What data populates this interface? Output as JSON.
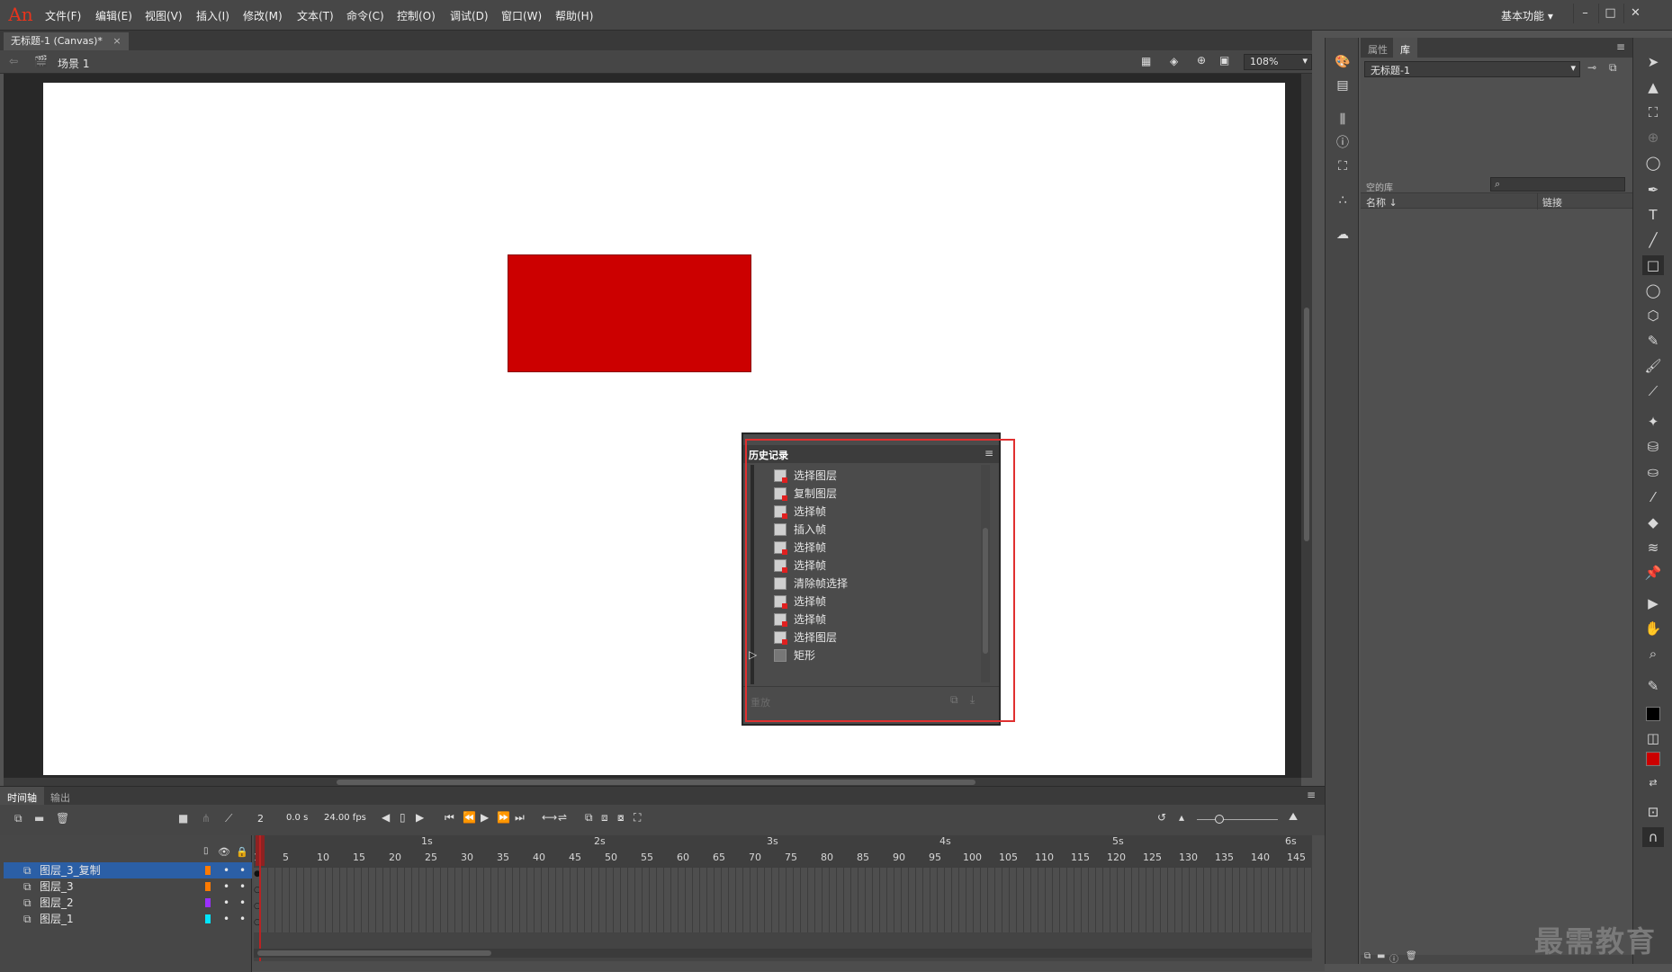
{
  "app": {
    "logo": "An"
  },
  "menu": [
    "文件(F)",
    "编辑(E)",
    "视图(V)",
    "插入(I)",
    "修改(M)",
    "文本(T)",
    "命令(C)",
    "控制(O)",
    "调试(D)",
    "窗口(W)",
    "帮助(H)"
  ],
  "workspace": "基本功能",
  "window_controls": [
    "–",
    "□",
    "✕"
  ],
  "doc_tab": {
    "title": "无标题-1 (Canvas)*",
    "close": "×"
  },
  "editbar": {
    "scene": "场景 1",
    "zoom": "108%"
  },
  "stage": {
    "shape_color": "#cc0000"
  },
  "history_panel": {
    "title": "历史记录",
    "items": [
      "选择图层",
      "复制图层",
      "选择帧",
      "插入帧",
      "选择帧",
      "选择帧",
      "清除帧选择",
      "选择帧",
      "选择帧",
      "选择图层",
      "矩形"
    ],
    "replay": "重放"
  },
  "right_panel": {
    "tabs": [
      "属性",
      "库"
    ],
    "doc_select": "无标题-1",
    "empty_label": "空的库",
    "col_name": "名称 ↓",
    "col_link": "链接"
  },
  "timeline": {
    "tabs": [
      "时间轴",
      "输出"
    ],
    "frame": "2",
    "time": "0.0 s",
    "fps": "24.00 fps",
    "seconds": [
      "1s",
      "2s",
      "3s",
      "4s",
      "5s",
      "6s"
    ],
    "frame_numbers": [
      "1",
      "5",
      "10",
      "15",
      "20",
      "25",
      "30",
      "35",
      "40",
      "45",
      "50",
      "55",
      "60",
      "65",
      "70",
      "75",
      "80",
      "85",
      "90",
      "95",
      "100",
      "105",
      "110",
      "115",
      "120",
      "125",
      "130",
      "135",
      "140",
      "145"
    ],
    "layers": [
      {
        "name": "图层_3_复制",
        "color": "#ff7a00",
        "selected": true
      },
      {
        "name": "图层_3",
        "color": "#ff7a00",
        "selected": false
      },
      {
        "name": "图层_2",
        "color": "#9b30ff",
        "selected": false
      },
      {
        "name": "图层_1",
        "color": "#00e5ff",
        "selected": false
      }
    ]
  },
  "watermark": "最需教育"
}
